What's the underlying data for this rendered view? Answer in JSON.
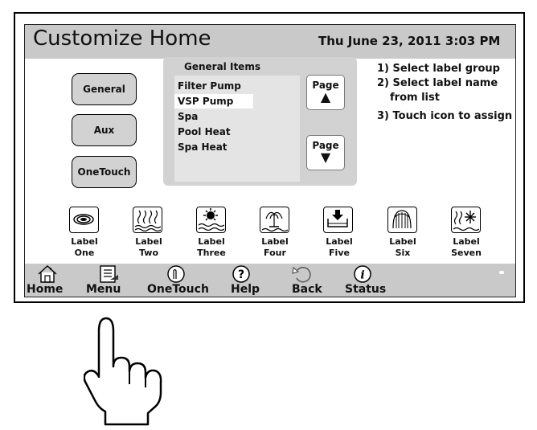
{
  "header": {
    "title": "Customize Home",
    "datetime": "Thu June 23, 2011  3:03 PM"
  },
  "groups": [
    {
      "label": "General"
    },
    {
      "label": "Aux"
    },
    {
      "label": "OneTouch"
    }
  ],
  "list_panel": {
    "title": "General Items",
    "items": [
      "Filter Pump",
      "VSP Pump",
      "Spa",
      "Pool Heat",
      "Spa Heat"
    ],
    "selected": "VSP Pump",
    "page_up": {
      "label": "Page",
      "arrow": "▲"
    },
    "page_down": {
      "label": "Page",
      "arrow": "▼"
    }
  },
  "instructions": [
    "1) Select label group",
    "2) Select label name",
    "from list",
    "3) Touch icon to assign"
  ],
  "labels": [
    {
      "line1": "Label",
      "line2": "One",
      "icon": "swirl-icon"
    },
    {
      "line1": "Label",
      "line2": "Two",
      "icon": "heat-waves-icon"
    },
    {
      "line1": "Label",
      "line2": "Three",
      "icon": "sun-water-icon"
    },
    {
      "line1": "Label",
      "line2": "Four",
      "icon": "fountain-icon"
    },
    {
      "line1": "Label",
      "line2": "Five",
      "icon": "drain-icon"
    },
    {
      "line1": "Label",
      "line2": "Six",
      "icon": "waterfall-icon"
    },
    {
      "line1": "Label",
      "line2": "Seven",
      "icon": "heat-snowflake-icon"
    }
  ],
  "nav": [
    {
      "label": "Home",
      "icon": "house-icon"
    },
    {
      "label": "Menu",
      "icon": "menu-notepad-icon"
    },
    {
      "label": "OneTouch",
      "icon": "onetouch-icon"
    },
    {
      "label": "Help",
      "icon": "help-icon"
    },
    {
      "label": "Back",
      "icon": "back-arrow-icon"
    },
    {
      "label": "Status",
      "icon": "info-icon"
    }
  ],
  "colors": {
    "header_bg": "#c9c9c9",
    "panel_bg": "#d2d2d2",
    "button_bg": "#d2d2d2"
  }
}
